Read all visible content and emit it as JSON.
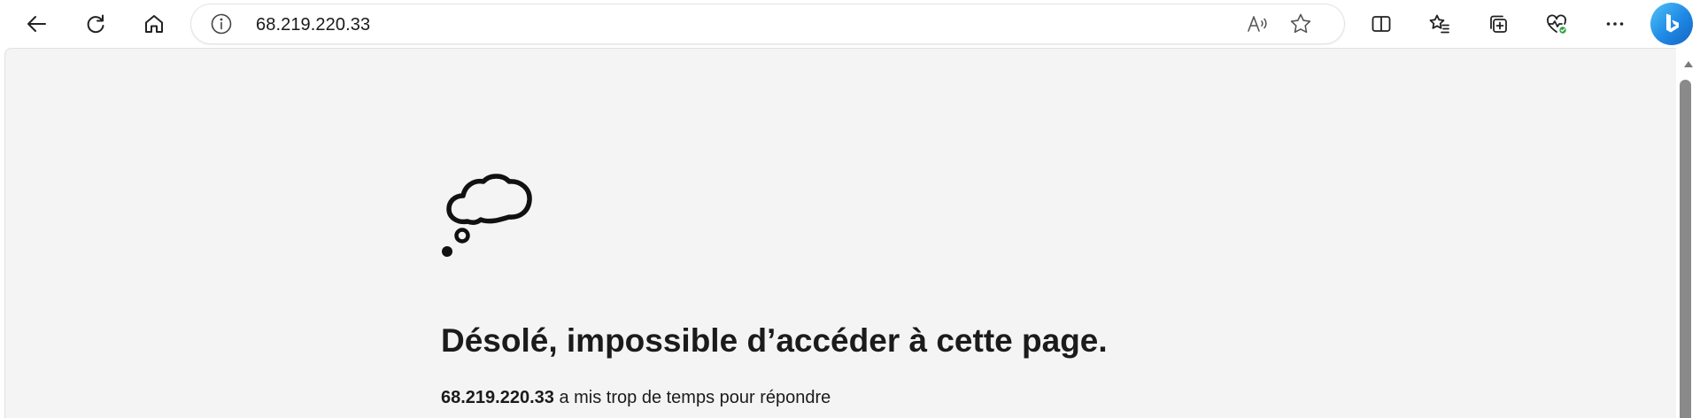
{
  "toolbar": {
    "back_label": "back",
    "refresh_label": "refresh",
    "home_label": "home"
  },
  "address_bar": {
    "url": "68.219.220.33"
  },
  "error_page": {
    "title": "Désolé, impossible d’accéder à cette page.",
    "host": "68.219.220.33",
    "message": " a mis trop de temps pour répondre"
  },
  "icons": {
    "back": "back-arrow-icon",
    "refresh": "refresh-icon",
    "home": "home-icon",
    "info": "info-icon",
    "read_aloud": "read-aloud-icon",
    "favorite": "star-icon",
    "split_screen": "split-screen-icon",
    "favorites": "favorites-icon",
    "collections": "collections-icon",
    "browser_essentials": "heart-pulse-icon",
    "more": "more-icon",
    "copilot": "bing-icon",
    "error": "thought-cloud-icon"
  },
  "colors": {
    "page_background": "#f4f4f4",
    "text": "#1b1b1b",
    "bing_accent": "#1e88e5",
    "status_green": "#2e9e3e"
  }
}
